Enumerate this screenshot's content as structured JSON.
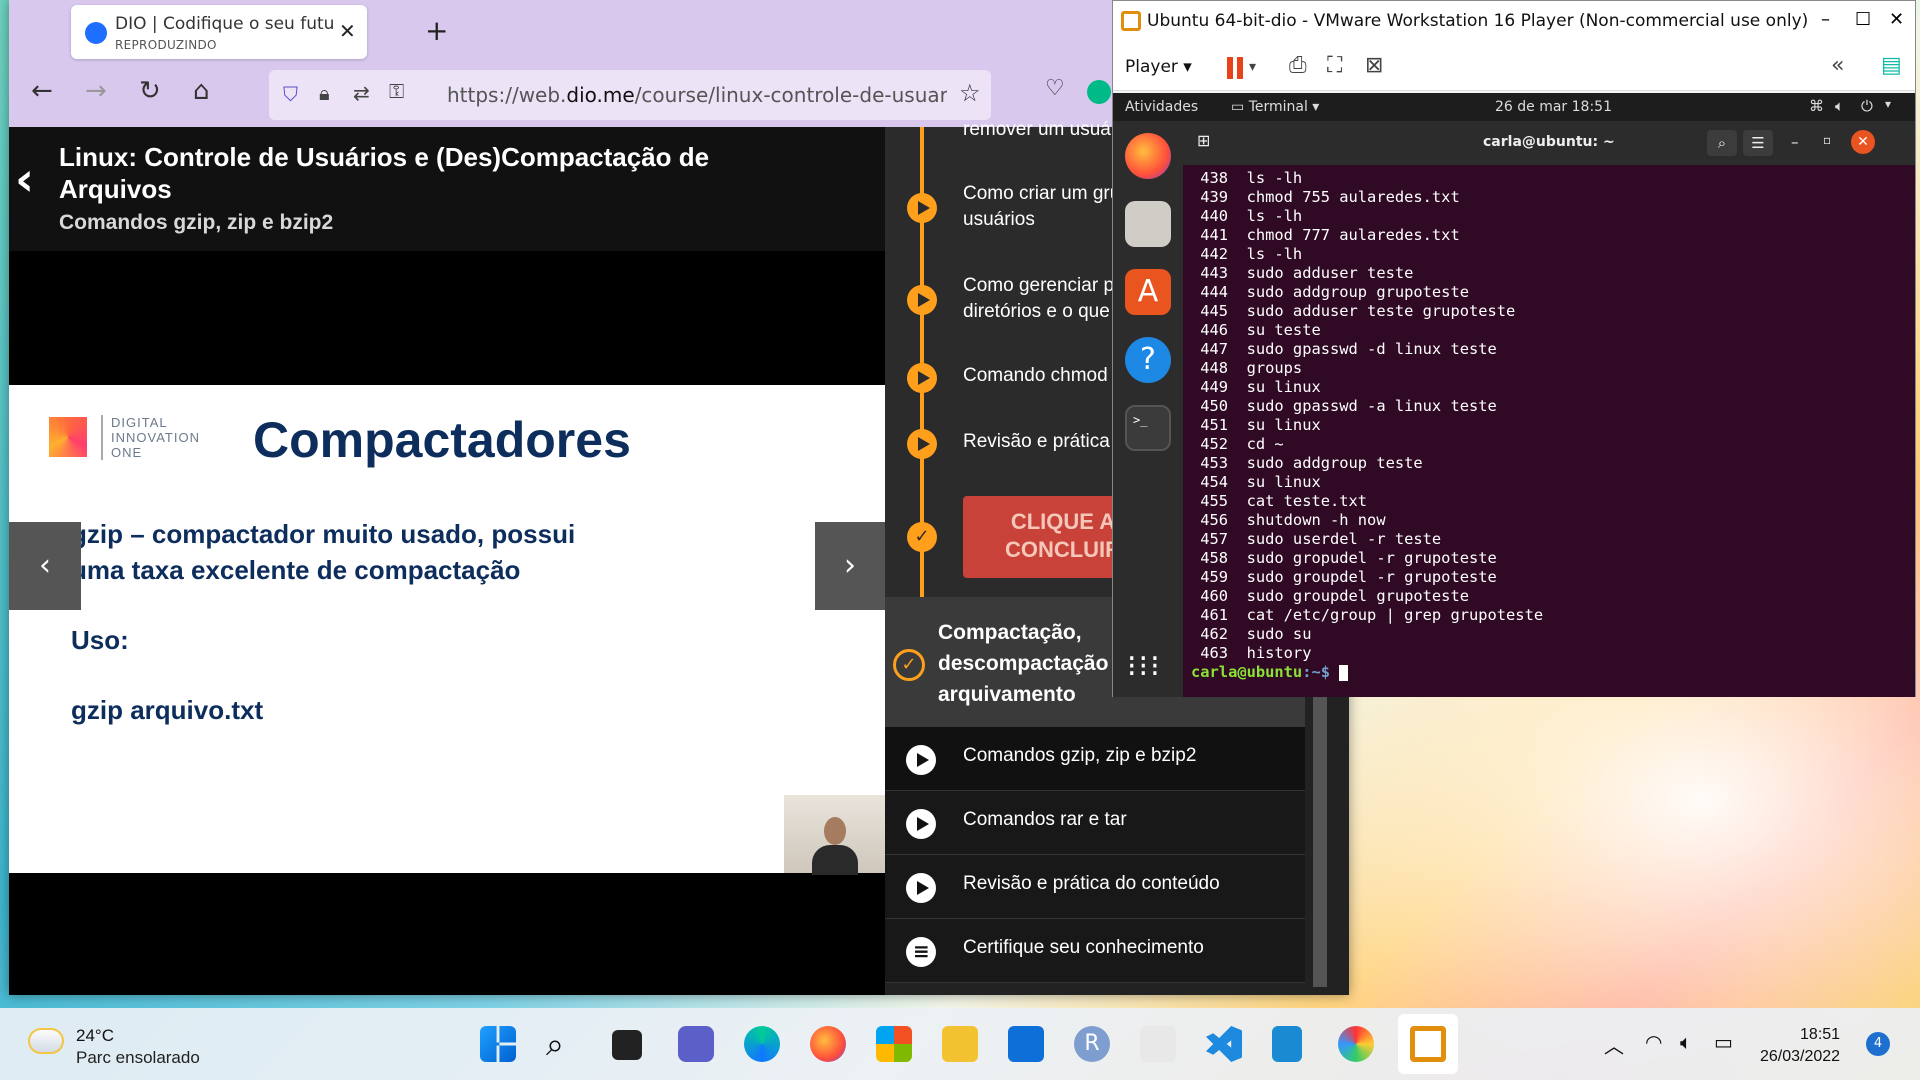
{
  "browser": {
    "tab_title": "DIO | Codifique o seu futuro glo",
    "tab_status": "REPRODUZINDO",
    "url_prefix": "https://web.",
    "url_domain": "dio.me",
    "url_path": "/course/linux-controle-de-usuarios"
  },
  "course": {
    "title": "Linux: Controle de Usuários e (Des)Compactação de Arquivos",
    "subtitle": "Comandos gzip, zip e bzip2"
  },
  "slide": {
    "logo_text_1": "DIGITAL",
    "logo_text_2": "INNOVATION",
    "logo_text_3": "ONE",
    "title": "Compactadores",
    "line1": "gzip – compactador muito usado, possui",
    "line2": "uma taxa excelente de compactação",
    "uso": "Uso:",
    "example": "gzip arquivo.txt"
  },
  "sidebar": {
    "top_items": [
      {
        "label": "remover um usuár"
      },
      {
        "label": "Como criar um gru\nusuários"
      },
      {
        "label": "Como gerenciar pe\ndiretórios e o que e"
      },
      {
        "label": "Comando chmod"
      },
      {
        "label": "Revisão e prática d"
      }
    ],
    "complete_button": "CLIQUE A\nCONCLUIR",
    "section_title": "Compactação,\ndescompactação e\narquivamento",
    "lessons": [
      {
        "label": "Comandos gzip, zip e bzip2",
        "icon": "play-icon"
      },
      {
        "label": "Comandos rar e tar",
        "icon": "play-icon"
      },
      {
        "label": "Revisão e prática do conteúdo",
        "icon": "play-icon"
      },
      {
        "label": "Certifique seu conhecimento",
        "icon": "list-icon"
      }
    ]
  },
  "vmware": {
    "title": "Ubuntu 64-bit-dio - VMware Workstation 16 Player (Non-commercial use only)",
    "player_menu": "Player"
  },
  "ubuntu": {
    "activities": "Atividades",
    "app_menu": "Terminal",
    "datetime": "26 de mar  18:51",
    "terminal_title": "carla@ubuntu: ~",
    "history": [
      " 438  ls -lh",
      " 439  chmod 755 aularedes.txt",
      " 440  ls -lh",
      " 441  chmod 777 aularedes.txt",
      " 442  ls -lh",
      " 443  sudo adduser teste",
      " 444  sudo addgroup grupoteste",
      " 445  sudo adduser teste grupoteste",
      " 446  su teste",
      " 447  sudo gpasswd -d linux teste",
      " 448  groups",
      " 449  su linux",
      " 450  sudo gpasswd -a linux teste",
      " 451  su linux",
      " 452  cd ~",
      " 453  sudo addgroup teste",
      " 454  su linux",
      " 455  cat teste.txt",
      " 456  shutdown -h now",
      " 457  sudo userdel -r teste",
      " 458  sudo gropudel -r grupoteste",
      " 459  sudo groupdel -r grupoteste",
      " 460  sudo groupdel grupoteste",
      " 461  cat /etc/group | grep grupoteste",
      " 462  sudo su",
      " 463  history"
    ],
    "prompt_user": "carla@ubuntu",
    "prompt_path": ":~$ "
  },
  "taskbar": {
    "temp": "24°C",
    "weather": "Parc ensolarado",
    "time": "18:51",
    "date": "26/03/2022",
    "notifications": "4"
  },
  "colors": {
    "accent_orange": "#ff9f1c",
    "slide_blue": "#0d2d5c",
    "terminal_bg": "#300a24",
    "browser_chrome": "#d9c8ee"
  }
}
